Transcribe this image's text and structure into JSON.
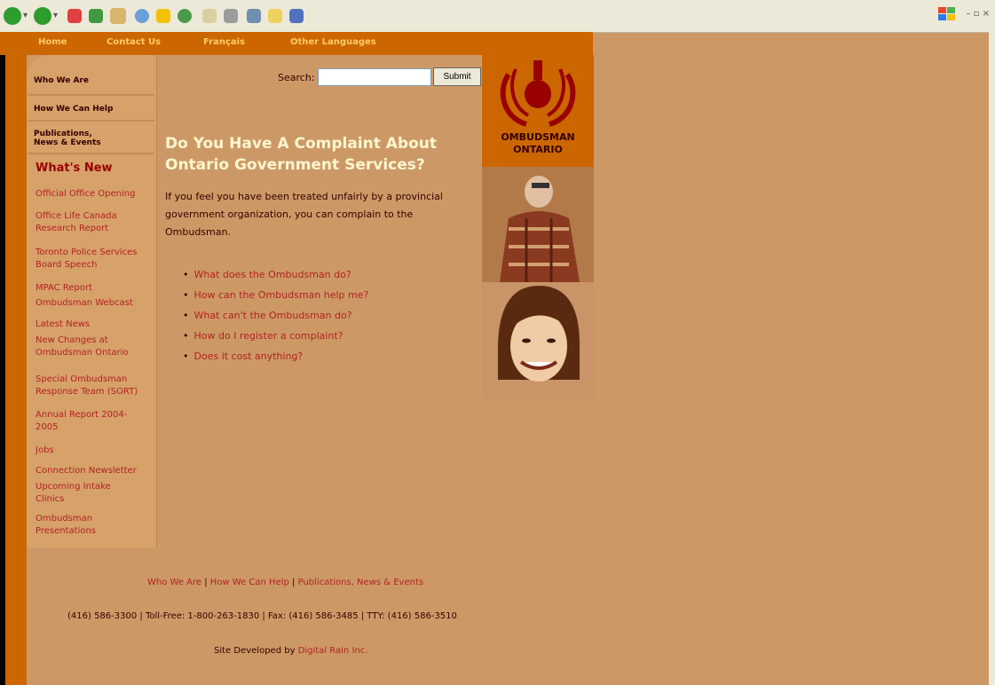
{
  "topnav": {
    "home": "Home",
    "contact": "Contact Us",
    "francais": "Français",
    "other_languages": "Other Languages"
  },
  "sidebar": {
    "nav": [
      "Who We Are",
      "How We Can Help",
      "Publications,",
      "News & Events"
    ],
    "whats_new": "What's New",
    "news_items": [
      "Official Office Opening",
      "Office Life Canada",
      "Research Report",
      "Toronto Police Services",
      "Board Speech",
      "MPAC Report",
      "Ombudsman Webcast",
      "Latest News",
      "New Changes at",
      "Ombudsman Ontario",
      "Special Ombudsman",
      "Response Team (SORT)",
      "Annual Report 2004-",
      "2005",
      "Jobs",
      "Connection Newsletter",
      "Upcoming Intake",
      "Clinics",
      "Ombudsman",
      "Presentations"
    ]
  },
  "search": {
    "label": "Search:",
    "submit": "Submit",
    "value": ""
  },
  "main": {
    "headline_1": "Do You Have A Complaint About",
    "headline_2": "Ontario Government Services?",
    "intro_1": "If you feel you have been treated unfairly by a provincial",
    "intro_2": "government organization, you can complain to the",
    "intro_3": "Ombudsman.",
    "faq": [
      "What does the Ombudsman do?",
      "How can the Ombudsman help me?",
      "What can't the Ombudsman do?",
      "How do I register a complaint?",
      "Does it cost anything?"
    ]
  },
  "logo": {
    "line1": "OMBUDSMAN",
    "line2": "ONTARIO"
  },
  "footer": {
    "links": [
      "Who We Are",
      "How We Can Help",
      "Publications, News & Events"
    ],
    "separator": "|",
    "contact": "(416) 586-3300  |  Toll-Free: 1-800-263-1830  |  Fax: (416) 586-3485  |  TTY: (416) 586-3510",
    "dev_prefix": "Site Developed by",
    "dev_link": "Digital Rain Inc."
  },
  "colors": {
    "page_bg": "#cc9966",
    "orange": "#cc6600",
    "link": "#b22222",
    "dark": "#330000",
    "headline": "#fff6d0"
  }
}
